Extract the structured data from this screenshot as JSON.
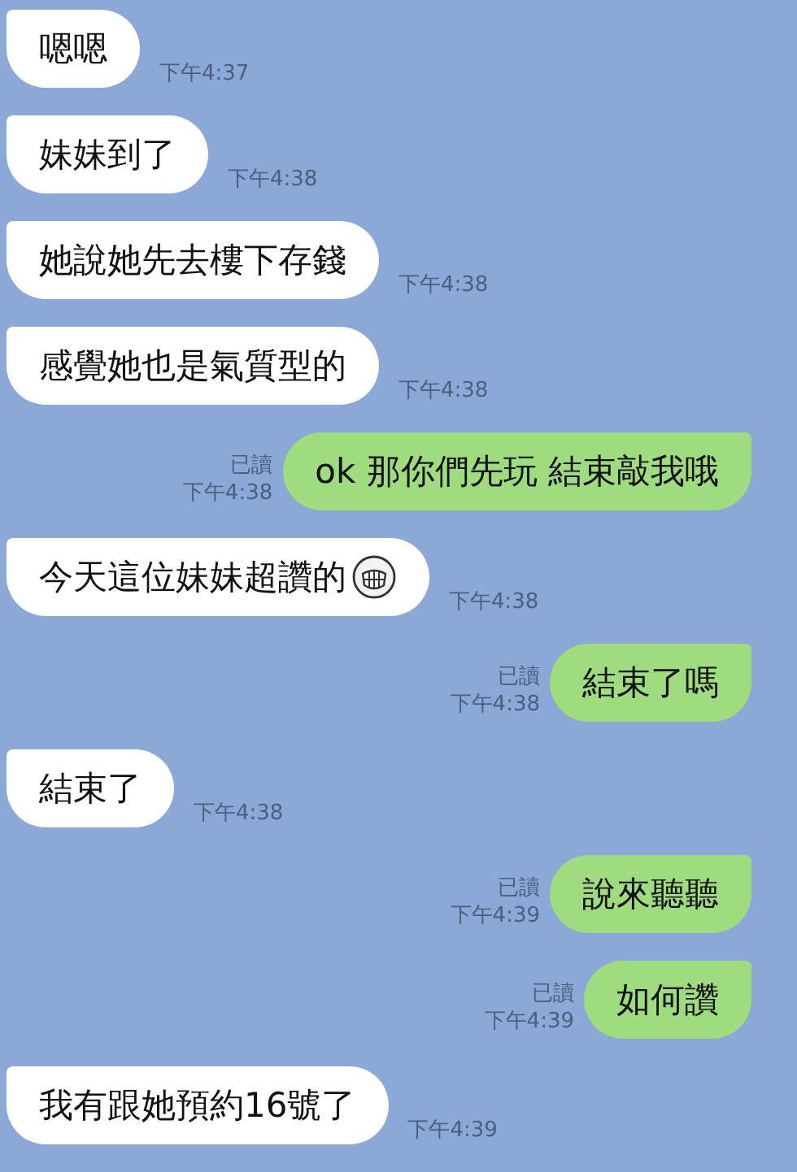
{
  "messages": [
    {
      "kind": "incoming",
      "text": "嗯嗯",
      "time": "下午4:37"
    },
    {
      "kind": "incoming",
      "text": "妹妹到了",
      "time": "下午4:38"
    },
    {
      "kind": "incoming",
      "text": "她說她先去樓下存錢",
      "time": "下午4:38"
    },
    {
      "kind": "incoming",
      "text": "感覺她也是氣質型的",
      "time": "下午4:38"
    },
    {
      "kind": "outgoing",
      "text": "ok 那你們先玩 結束敲我哦",
      "time": "下午4:38",
      "read": "已讀"
    },
    {
      "kind": "incoming",
      "text": "今天這位妹妹超讚的",
      "time": "下午4:38",
      "emoji": true
    },
    {
      "kind": "outgoing",
      "text": "結束了嗎",
      "time": "下午4:38",
      "read": "已讀"
    },
    {
      "kind": "incoming",
      "text": "結束了",
      "time": "下午4:38"
    },
    {
      "kind": "outgoing",
      "text": "說來聽聽",
      "time": "下午4:39",
      "read": "已讀"
    },
    {
      "kind": "outgoing",
      "text": "如何讚",
      "time": "下午4:39",
      "read": "已讀"
    },
    {
      "kind": "incoming",
      "text": "我有跟她預約16號了",
      "time": "下午4:39"
    }
  ]
}
